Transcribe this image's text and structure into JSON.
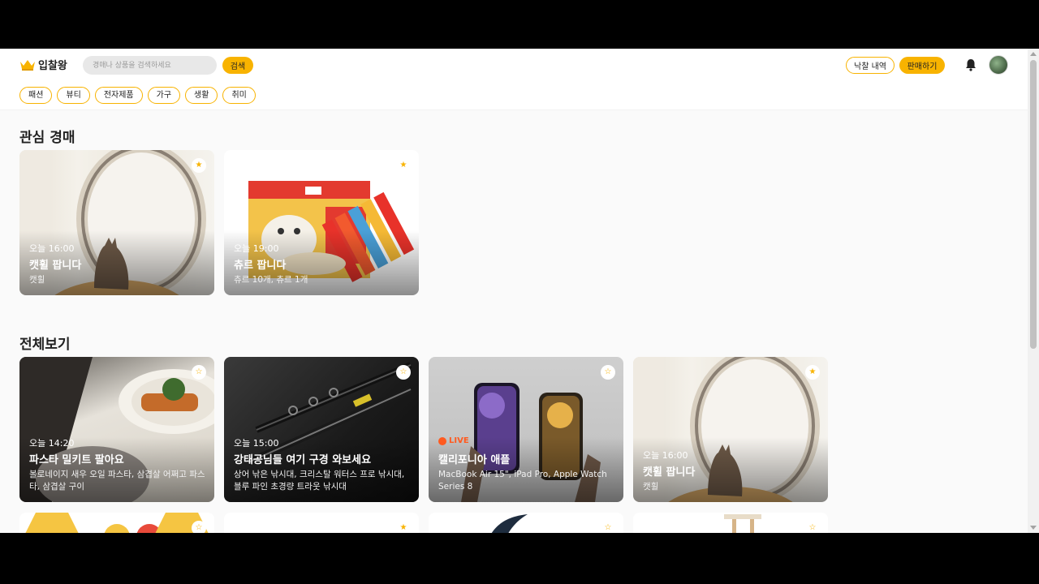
{
  "header": {
    "logo_text": "입찰왕",
    "search_placeholder": "경매나 상품을 검색하세요",
    "search_button": "검색",
    "bid_history_button": "낙찰 내역",
    "sell_button": "판매하기"
  },
  "categories": [
    "패션",
    "뷰티",
    "전자제품",
    "가구",
    "생활",
    "취미"
  ],
  "favorites": {
    "title": "관심 경매",
    "cards": [
      {
        "time": "오늘 16:00",
        "title": "캣휠 팝니다",
        "desc": "캣휠",
        "star": "★"
      },
      {
        "time": "오늘 19:00",
        "title": "츄르 팝니다",
        "desc": "츄르 10개, 츄르 1개",
        "star": "★"
      }
    ]
  },
  "all": {
    "title": "전체보기",
    "cards": [
      {
        "time": "오늘 14:20",
        "title": "파스타 밀키트 팔아요",
        "desc": "볼로네이지 새우 오일 파스타, 삼겹살 어쩌고 파스타, 삼겹살 구이",
        "star": "☆"
      },
      {
        "time": "오늘 15:00",
        "title": "강태공님들 여기 구경 와보세요",
        "desc": "상어 낚은 낚시대, 크리스탈 워터스 프로 낚시대, 블루 파인 초경량 트라웃 낚시대",
        "star": "☆"
      },
      {
        "live": "LIVE",
        "title": "캘리포니아 애플",
        "desc": "MacBook Air 15\", iPad Pro, Apple Watch Series 8",
        "star": "☆"
      },
      {
        "time": "오늘 16:00",
        "title": "캣휠 팝니다",
        "desc": "캣휠",
        "star": "★"
      }
    ],
    "next_row_stars": [
      "☆",
      "★",
      "☆",
      "☆"
    ]
  },
  "colors": {
    "accent": "#f8b300",
    "live": "#ff5a1f"
  }
}
